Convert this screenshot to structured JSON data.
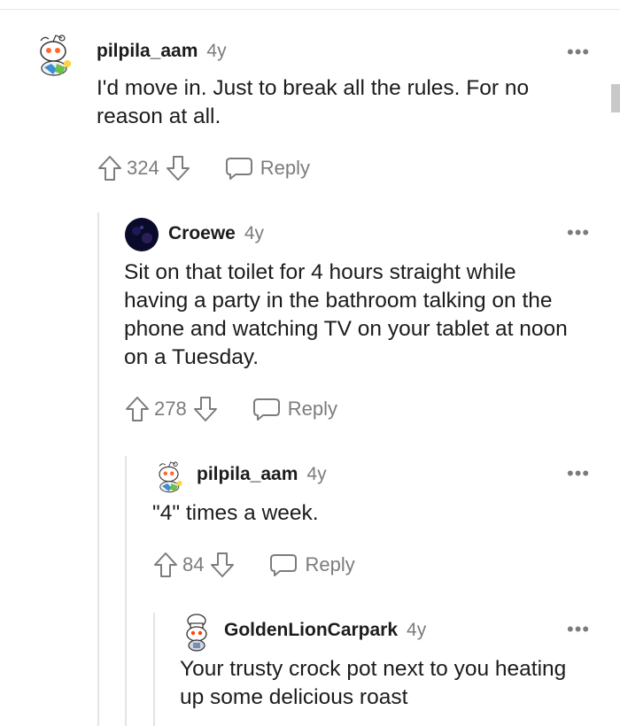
{
  "comments": [
    {
      "user": "pilpila_aam",
      "age": "4y",
      "text": "I'd move in. Just to break all the rules. For no reason at all.",
      "votes": "324",
      "reply_label": "Reply",
      "more": "•••",
      "avatar": "snoo-avatar"
    },
    {
      "user": "Croewe",
      "age": "4y",
      "text": "Sit on that toilet for 4 hours straight while having a party in the bathroom talking on the phone and watching TV on your tablet at noon on a Tuesday.",
      "votes": "278",
      "reply_label": "Reply",
      "more": "•••",
      "avatar": "dark-avatar"
    },
    {
      "user": "pilpila_aam",
      "age": "4y",
      "text": "\"4\" times a week.",
      "votes": "84",
      "reply_label": "Reply",
      "more": "•••",
      "avatar": "snoo-avatar"
    },
    {
      "user": "GoldenLionCarpark",
      "age": "4y",
      "text": "Your trusty crock pot next to you heating up some delicious roast",
      "more": "•••",
      "avatar": "chef-snoo-avatar"
    }
  ],
  "colors": {
    "text": "#1c1c1c",
    "muted": "#7c7c7c",
    "thread_line": "#e4e4e4"
  },
  "icons": [
    "upvote-icon",
    "downvote-icon",
    "reply-icon",
    "more-icon"
  ]
}
